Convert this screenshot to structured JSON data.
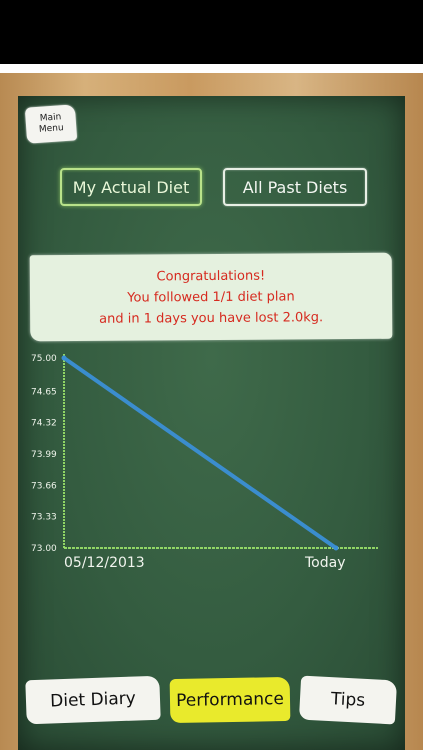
{
  "header": {
    "main_menu_line1": "Main",
    "main_menu_line2": "Menu"
  },
  "diet_toggle": {
    "actual_label": "My Actual Diet",
    "past_label": "All Past Diets",
    "selected": "actual"
  },
  "message": {
    "line1": "Congratulations!",
    "line2": "You followed 1/1 diet plan",
    "line3": "and in 1 days you have lost 2.0kg."
  },
  "chart_data": {
    "type": "line",
    "x": [
      "05/12/2013",
      "Today"
    ],
    "series": [
      {
        "values": [
          75.0,
          73.0
        ]
      }
    ],
    "y_ticks": [
      "75.00",
      "74.65",
      "74.32",
      "73.99",
      "73.66",
      "73.33",
      "73.00"
    ],
    "ylim": [
      73.0,
      75.0
    ],
    "grid": false,
    "line_color": "#3b8fd6",
    "axis_color": "#9be36a"
  },
  "tabs": [
    {
      "label": "Diet Diary",
      "selected": false
    },
    {
      "label": "Performance",
      "selected": true
    },
    {
      "label": "Tips",
      "selected": false
    }
  ]
}
